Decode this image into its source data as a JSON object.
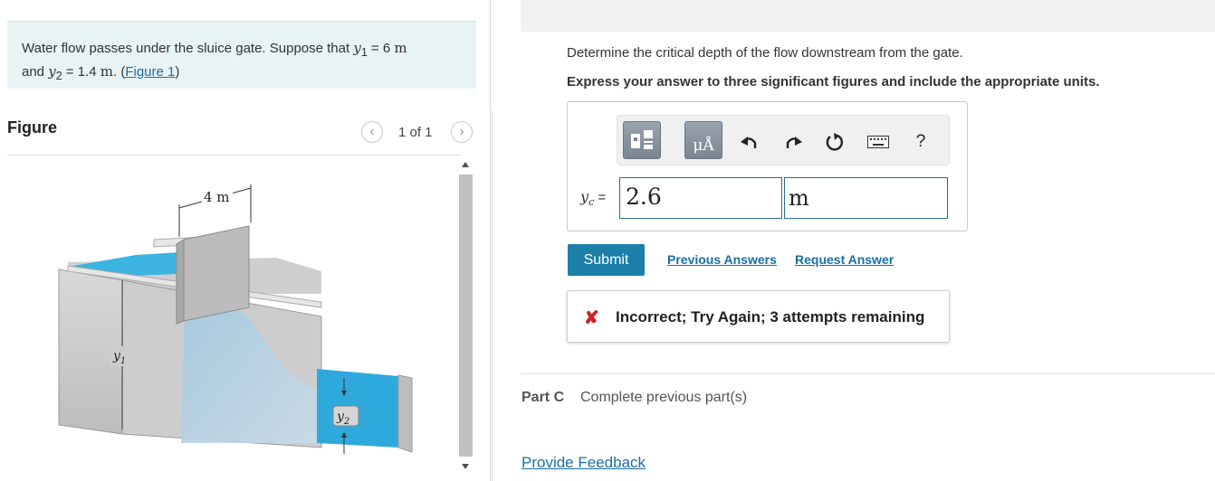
{
  "problem": {
    "text_before_y1": "Water flow passes under the sluice gate. Suppose that ",
    "y1_symbol": "y",
    "y1_sub": "1",
    "y1_eq": " = 6 ",
    "y1_unit": "m",
    "and_text": "and ",
    "y2_symbol": "y",
    "y2_sub": "2",
    "y2_eq": " = 1.4 ",
    "y2_unit": "m",
    "dot": ". (",
    "figure_link": "Figure 1",
    "close": ")"
  },
  "figure": {
    "title": "Figure",
    "pager_count": "1 of 1",
    "prev_icon": "chevron-left-icon",
    "next_icon": "chevron-right-icon",
    "dimension_label": "4 m",
    "y1_label": "y",
    "y1_sub": "1",
    "y2_label": "y",
    "y2_sub": "2"
  },
  "question": {
    "prompt": "Determine the critical depth of the flow downstream from the gate.",
    "instruction": "Express your answer to three significant figures and include the appropriate units."
  },
  "toolbar": {
    "templates_icon": "templates-icon",
    "units_label": "μÅ",
    "undo_icon": "undo-icon",
    "redo_icon": "redo-icon",
    "reset_icon": "reset-icon",
    "keyboard_icon": "keyboard-icon",
    "help_label": "?"
  },
  "answer": {
    "var_symbol": "y",
    "var_sub": "c",
    "equals": " =",
    "value": "2.6",
    "unit": "m"
  },
  "actions": {
    "submit_label": "Submit",
    "previous_answers_label": "Previous Answers",
    "request_answer_label": "Request Answer"
  },
  "feedback": {
    "icon": "x-icon",
    "mark": "✘",
    "text": "Incorrect; Try Again; 3 attempts remaining",
    "color": "#d32020"
  },
  "part_c": {
    "label": "Part C",
    "text": "Complete previous part(s)"
  },
  "footer": {
    "provide_feedback_label": "Provide Feedback"
  },
  "colors": {
    "accent": "#1c7fa8",
    "link": "#1a6fa5",
    "problem_bg": "#e8f3f3",
    "water": "#3bb4e0"
  }
}
